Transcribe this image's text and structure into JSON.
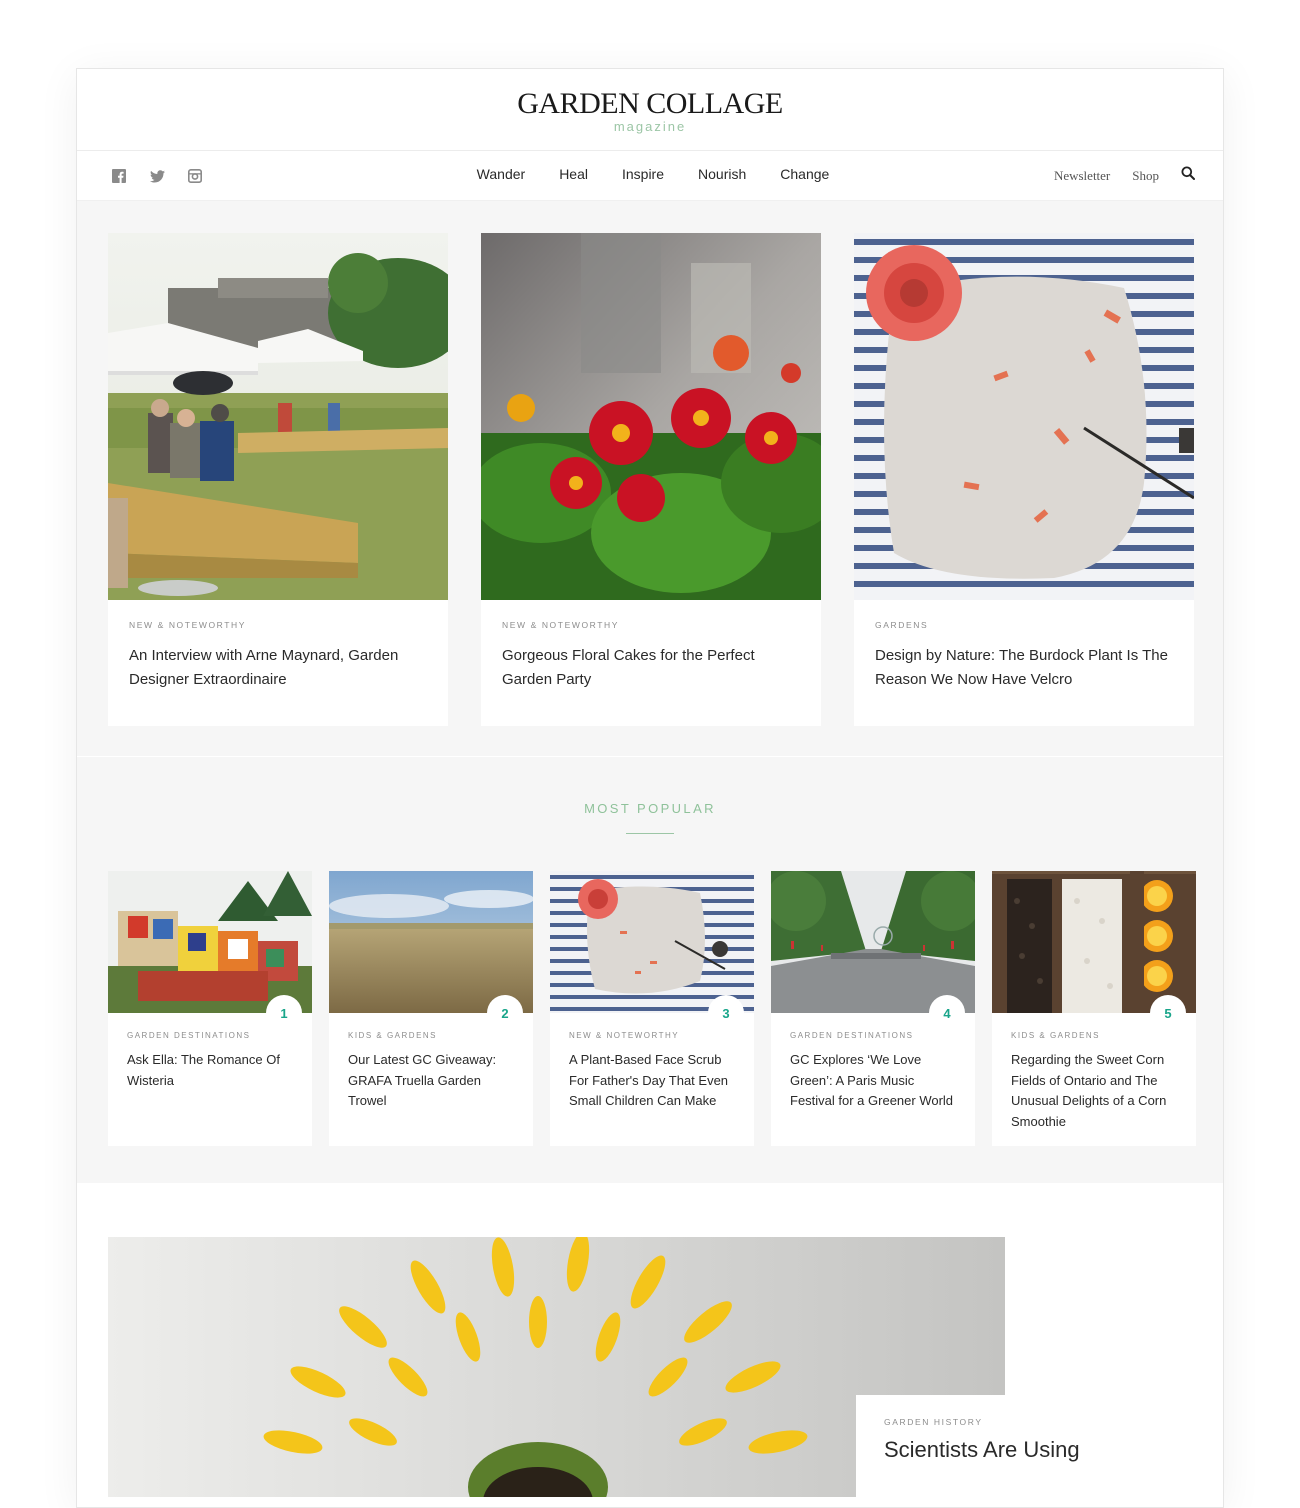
{
  "brand": {
    "title": "GARDEN COLLAGE",
    "subtitle": "magazine"
  },
  "nav": {
    "social": [
      "facebook-icon",
      "twitter-icon",
      "instagram-icon"
    ],
    "items": [
      "Wander",
      "Heal",
      "Inspire",
      "Nourish",
      "Change"
    ],
    "newsletter": "Newsletter",
    "shop": "Shop",
    "search_icon": "search-icon"
  },
  "featured": [
    {
      "kicker": "NEW & NOTEWORTHY",
      "title": "An Interview with Arne Maynard, Garden Designer Extraordinaire"
    },
    {
      "kicker": "NEW & NOTEWORTHY",
      "title": "Gorgeous Floral Cakes for the Perfect Garden Party"
    },
    {
      "kicker": "GARDENS",
      "title": "Design by Nature: The Burdock Plant Is The Reason We Now Have Velcro"
    }
  ],
  "popular": {
    "heading": "MOST POPULAR",
    "items": [
      {
        "rank": "1",
        "kicker": "GARDEN DESTINATIONS",
        "title": "Ask Ella: The Romance Of Wisteria"
      },
      {
        "rank": "2",
        "kicker": "KIDS & GARDENS",
        "title": "Our Latest GC Giveaway: GRAFA Truella Garden Trowel"
      },
      {
        "rank": "3",
        "kicker": "NEW & NOTEWORTHY",
        "title": "A Plant-Based Face Scrub For Father's Day That Even Small Children Can Make"
      },
      {
        "rank": "4",
        "kicker": "GARDEN DESTINATIONS",
        "title": "GC Explores ‘We Love Green’: A Paris Music Festival for a Greener World"
      },
      {
        "rank": "5",
        "kicker": "KIDS & GARDENS",
        "title": "Regarding the Sweet Corn Fields of Ontario and The Unusual Delights of a Corn Smoothie"
      }
    ]
  },
  "bottom": {
    "kicker": "GARDEN HISTORY",
    "title": "Scientists Are Using"
  },
  "colors": {
    "accent": "#19a58a",
    "green_heading": "#8fc29a",
    "background": "#f6f6f6"
  }
}
